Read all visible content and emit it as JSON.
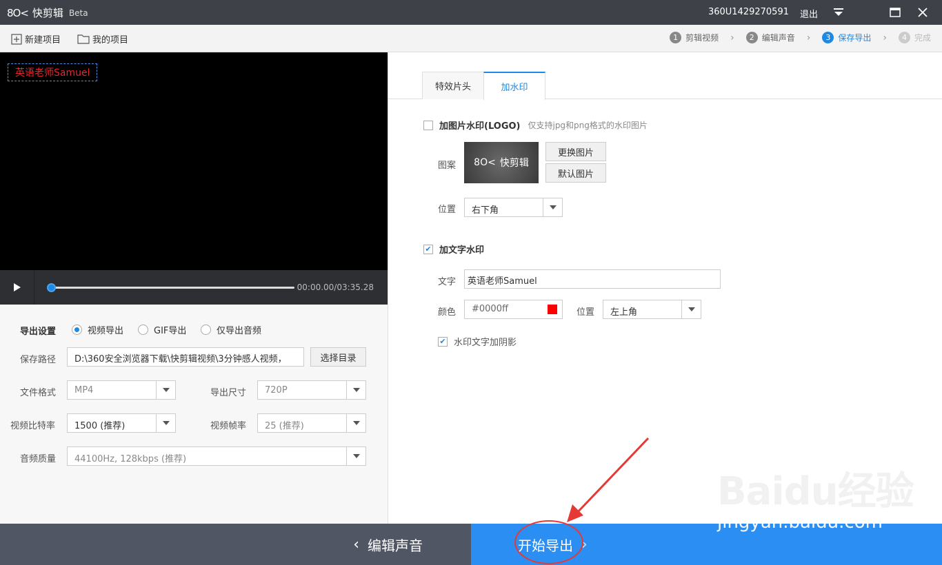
{
  "app": {
    "name": "快剪辑",
    "beta": "Beta",
    "logo_mark": "8O<"
  },
  "titlebar": {
    "user_id": "360U1429270591",
    "logout": "退出"
  },
  "toolbar": {
    "new_project": "新建项目",
    "my_projects": "我的项目"
  },
  "steps": [
    {
      "num": "1",
      "label": "剪辑视频",
      "state": "done"
    },
    {
      "num": "2",
      "label": "编辑声音",
      "state": "done"
    },
    {
      "num": "3",
      "label": "保存导出",
      "state": "active"
    },
    {
      "num": "4",
      "label": "完成",
      "state": "disabled"
    }
  ],
  "video": {
    "watermark_text": "英语老师Samuel",
    "timecode": "00:00.00/03:35.28",
    "progress": 0
  },
  "export": {
    "section_label": "导出设置",
    "modes": [
      "视频导出",
      "GIF导出",
      "仅导出音频"
    ],
    "selected_mode": "视频导出",
    "path_label": "保存路径",
    "path_value": "D:\\360安全浏览器下载\\快剪辑视频\\3分钟感人视频，",
    "choose_dir": "选择目录",
    "format_label": "文件格式",
    "format_value": "MP4",
    "size_label": "导出尺寸",
    "size_value": "720P",
    "bitrate_label": "视频比特率",
    "bitrate_value": "1500 (推荐)",
    "fps_label": "视频帧率",
    "fps_value": "25 (推荐)",
    "audio_label": "音频质量",
    "audio_value": "44100Hz, 128kbps (推荐)"
  },
  "tabs": [
    {
      "label": "特效片头"
    },
    {
      "label": "加水印"
    }
  ],
  "watermark": {
    "image_checkbox_label": "加图片水印(LOGO)",
    "image_checked": false,
    "image_hint": "仅支持jpg和png格式的水印图片",
    "pattern_label": "图案",
    "thumb_text": "快剪辑",
    "replace_image": "更换图片",
    "default_image": "默认图片",
    "position_label": "位置",
    "image_position": "右下角",
    "text_checkbox_label": "加文字水印",
    "text_checked": true,
    "text_label": "文字",
    "text_value": "英语老师Samuel",
    "color_label": "颜色",
    "color_value": "#0000ff",
    "swatch_color": "#ff0000",
    "text_position_label": "位置",
    "text_position": "左上角",
    "shadow_label": "水印文字加阴影",
    "shadow_checked": true
  },
  "bottom": {
    "back_label": "编辑声音",
    "export_label": "开始导出"
  },
  "overlay": {
    "baidu_logo": "Baidu经验",
    "baidu_url": "jingyan.baidu.com"
  },
  "colors": {
    "accent": "#1e88e5",
    "title_bg": "#3e4147",
    "export_bg": "#2b8ef2",
    "back_bg": "#505663",
    "annotation": "#e53935"
  }
}
